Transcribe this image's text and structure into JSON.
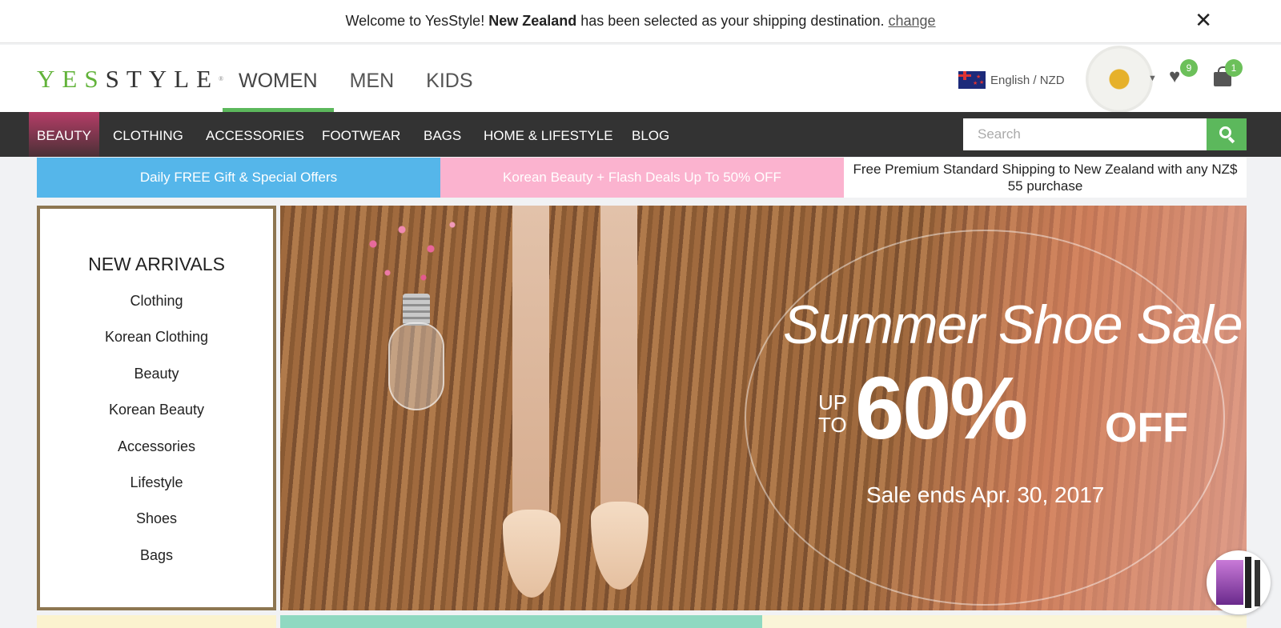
{
  "notice": {
    "prefix": "Welcome to YesStyle!",
    "country": "New Zealand",
    "suffix": "has been selected as your shipping destination.",
    "change_label": "change",
    "close_label": "✕"
  },
  "header": {
    "logo_yes": "YES",
    "logo_style": "STYLE",
    "logo_mark": "®",
    "gender_tabs": [
      {
        "label": "WOMEN",
        "active": true
      },
      {
        "label": "MEN",
        "active": false
      },
      {
        "label": "KIDS",
        "active": false
      }
    ],
    "locale_label": "English / NZD",
    "wishlist_count": "9",
    "cart_count": "1"
  },
  "categories": [
    {
      "label": "BEAUTY",
      "active": true
    },
    {
      "label": "CLOTHING",
      "active": false
    },
    {
      "label": "ACCESSORIES",
      "active": false
    },
    {
      "label": "FOOTWEAR",
      "active": false
    },
    {
      "label": "BAGS",
      "active": false
    },
    {
      "label": "HOME & LIFESTYLE",
      "active": false
    },
    {
      "label": "BLOG",
      "active": false
    }
  ],
  "search": {
    "placeholder": "Search"
  },
  "promos": [
    "Daily FREE Gift & Special Offers",
    "Korean Beauty + Flash Deals Up To 50% OFF",
    "Free Premium Standard Shipping to New Zealand with any NZ$ 55 purchase"
  ],
  "new_arrivals": {
    "title": "NEW ARRIVALS",
    "items": [
      "Clothing",
      "Korean Clothing",
      "Beauty",
      "Korean Beauty",
      "Accessories",
      "Lifestyle",
      "Shoes",
      "Bags"
    ]
  },
  "banner": {
    "title": "Summer Shoe Sale",
    "up": "UP",
    "to": "TO",
    "percent": "60%",
    "off": "OFF",
    "ends": "Sale ends Apr. 30, 2017"
  },
  "colors": {
    "brand_green": "#5cb85c",
    "category_bar": "#333333",
    "promo_blue": "#55b6ea",
    "promo_pink": "#fbb3cf",
    "arrivals_border": "#8d7651"
  },
  "icons": [
    "close-icon",
    "flag-nz-icon",
    "avatar-daisy",
    "chevron-down-icon",
    "heart-icon",
    "bag-icon",
    "search-icon"
  ]
}
